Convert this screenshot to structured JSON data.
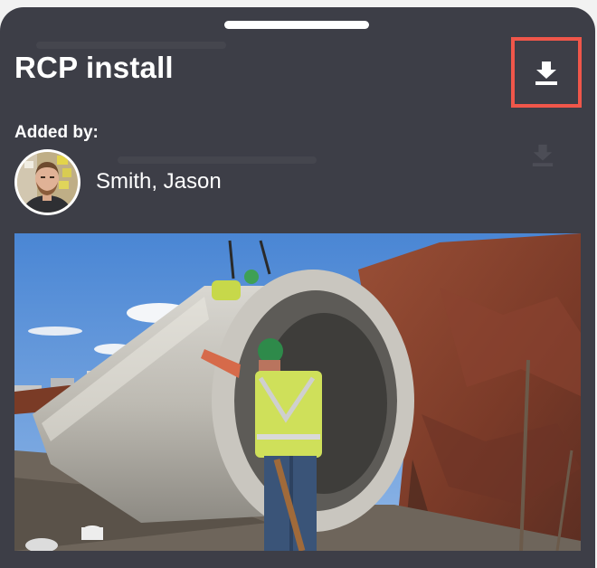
{
  "sheet": {
    "title": "RCP install",
    "added_by_label": "Added by:",
    "user": {
      "name": "Smith, Jason",
      "avatar_icon": "user-avatar-photo"
    },
    "download_icon": "download-icon",
    "highlight_color": "#f0564a",
    "background_color": "#3d3e47",
    "photo_subject": "worker-guiding-concrete-pipe-photo"
  }
}
